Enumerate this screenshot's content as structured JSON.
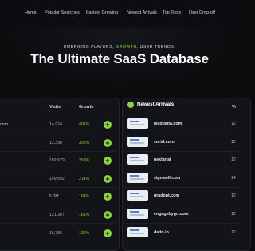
{
  "nav": {
    "items": [
      "Home",
      "Popular Searches",
      "Fastest Growing",
      "Newest Arrivals",
      "Top Tools",
      "User Drop-off"
    ]
  },
  "hero": {
    "tagline_part1": "EMERGING PLAYERS,",
    "tagline_part2": "GROWTH,",
    "tagline_part3": "USER TRENDS.",
    "headline": "The Ultimate SaaS Database"
  },
  "left_table": {
    "headers": {
      "visits": "Visits",
      "growth": "Growth"
    },
    "rows": [
      {
        "domain": "com",
        "visits": "14,924",
        "growth": "401%"
      },
      {
        "domain": "",
        "visits": "12,398",
        "growth": "302%"
      },
      {
        "domain": "",
        "visits": "192,979",
        "growth": "268%"
      },
      {
        "domain": "",
        "visits": "149,592",
        "growth": "214%"
      },
      {
        "domain": "",
        "visits": "5.0M",
        "growth": "164%"
      },
      {
        "domain": "",
        "visits": "121,307",
        "growth": "161%"
      },
      {
        "domain": "",
        "visits": "16,786",
        "growth": "132%"
      }
    ],
    "action_label": "+"
  },
  "newest_arrivals": {
    "title": "Newest Arrivals",
    "visits_header": "Vi",
    "rows": [
      {
        "domain": "leaddelta.com",
        "visits": "12"
      },
      {
        "domain": "sortd.com",
        "visits": "12"
      },
      {
        "domain": "nektar.ai",
        "visits": "12"
      },
      {
        "domain": "signwell.com",
        "visits": "14"
      },
      {
        "domain": "gradgpt.com",
        "visits": "12"
      },
      {
        "domain": "engagebygo.com",
        "visits": "12"
      },
      {
        "domain": "daito.io",
        "visits": "12"
      }
    ]
  },
  "colors": {
    "accent": "#8bd63c",
    "background": "#0b0c0e",
    "panel": "#121418"
  }
}
